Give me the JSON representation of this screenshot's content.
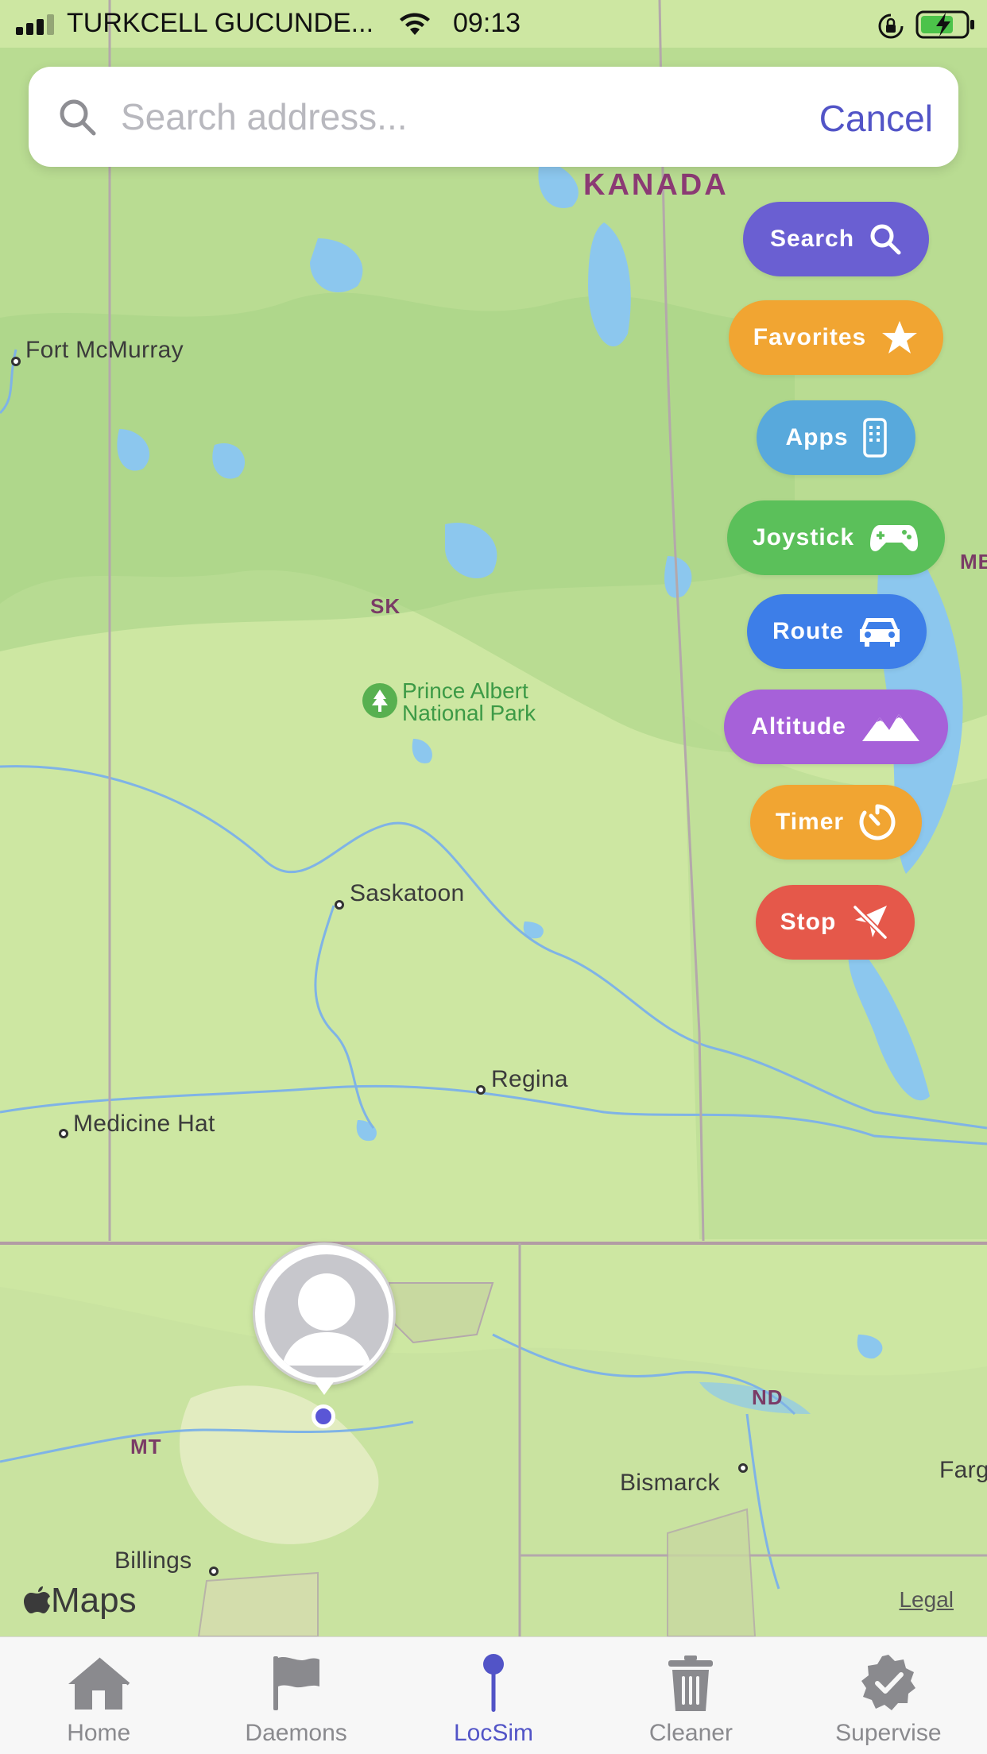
{
  "status_bar": {
    "carrier": "TURKCELL GUCUNDE...",
    "time": "09:13"
  },
  "search": {
    "placeholder": "Search address...",
    "cancel_label": "Cancel"
  },
  "map": {
    "country_label": "KANADA",
    "places": {
      "fort_mcmurray": "Fort McMurray",
      "saskatoon": "Saskatoon",
      "regina": "Regina",
      "medicine_hat": "Medicine Hat",
      "bismarck": "Bismarck",
      "billings": "Billings",
      "fargo": "Farg"
    },
    "regions": {
      "sk": "SK",
      "mt": "MT",
      "nd": "ND",
      "mb": "MB"
    },
    "park": {
      "line1": "Prince Albert",
      "line2": "National Park"
    },
    "attribution": "Maps",
    "legal": "Legal"
  },
  "actions": [
    {
      "label": "Search",
      "icon": "search-icon",
      "color": "#6a5fd2"
    },
    {
      "label": "Favorites",
      "icon": "star-icon",
      "color": "#f1a532"
    },
    {
      "label": "Apps",
      "icon": "phone-icon",
      "color": "#58a9dc"
    },
    {
      "label": "Joystick",
      "icon": "gamepad-icon",
      "color": "#5bc05a"
    },
    {
      "label": "Route",
      "icon": "car-icon",
      "color": "#3d7ee8"
    },
    {
      "label": "Altitude",
      "icon": "mountain-icon",
      "color": "#a661d9"
    },
    {
      "label": "Timer",
      "icon": "timer-icon",
      "color": "#f1a532"
    },
    {
      "label": "Stop",
      "icon": "location-slash-icon",
      "color": "#e5584a"
    }
  ],
  "tabs": [
    {
      "label": "Home",
      "icon": "house-icon"
    },
    {
      "label": "Daemons",
      "icon": "flag-icon"
    },
    {
      "label": "LocSim",
      "icon": "map-pin-icon",
      "active": true
    },
    {
      "label": "Cleaner",
      "icon": "trash-icon"
    },
    {
      "label": "Supervise",
      "icon": "checkmark-seal-icon"
    }
  ],
  "colors": {
    "accent": "#5254c7",
    "map_land": "#cde7a2",
    "map_water": "#8cc7ee"
  }
}
